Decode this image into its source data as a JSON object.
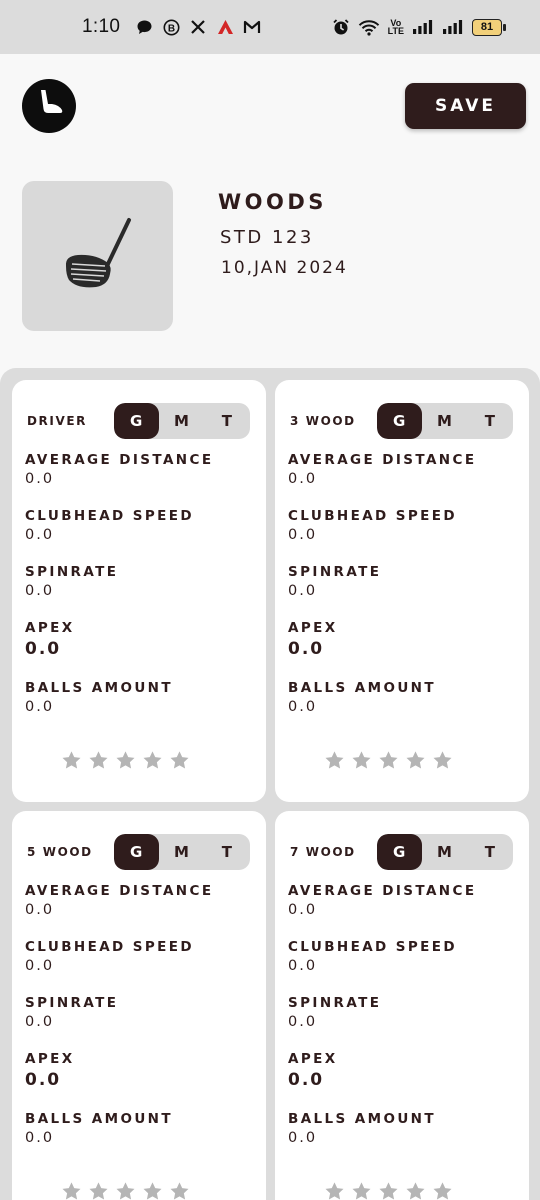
{
  "status_bar": {
    "time": "1:10",
    "volte_line1": "Vo",
    "volte_line2": "LTE",
    "battery": "81"
  },
  "header": {
    "save_label": "SAVE"
  },
  "club_info": {
    "title": "WOODS",
    "subtitle": "STD 123",
    "date": "10,JAN 2024"
  },
  "segment_options": [
    "G",
    "M",
    "T"
  ],
  "colors": {
    "primary": "#2f1c1c",
    "background": "#f8f8f8",
    "panel": "#dcdcdc",
    "star": "#b5b5b5"
  },
  "icons": {
    "logo": "golf-club-logo-icon",
    "club_image": "golf-driver-icon",
    "rating": "star-icon"
  },
  "cards": [
    {
      "name": "DRIVER",
      "selected": "G",
      "stats": [
        {
          "label": "AVERAGE DISTANCE",
          "value": "0.0"
        },
        {
          "label": "CLUBHEAD SPEED",
          "value": "0.0"
        },
        {
          "label": "SPINRATE",
          "value": "0.0"
        },
        {
          "label": "APEX",
          "value": "0.0"
        },
        {
          "label": "BALLS AMOUNT",
          "value": "0.0"
        }
      ],
      "rating": 0
    },
    {
      "name": "3 WOOD",
      "selected": "G",
      "stats": [
        {
          "label": "AVERAGE DISTANCE",
          "value": "0.0"
        },
        {
          "label": "CLUBHEAD SPEED",
          "value": "0.0"
        },
        {
          "label": "SPINRATE",
          "value": "0.0"
        },
        {
          "label": "APEX",
          "value": "0.0"
        },
        {
          "label": "BALLS AMOUNT",
          "value": "0.0"
        }
      ],
      "rating": 0
    },
    {
      "name": "5 WOOD",
      "selected": "G",
      "stats": [
        {
          "label": "AVERAGE DISTANCE",
          "value": "0.0"
        },
        {
          "label": "CLUBHEAD SPEED",
          "value": "0.0"
        },
        {
          "label": "SPINRATE",
          "value": "0.0"
        },
        {
          "label": "APEX",
          "value": "0.0"
        },
        {
          "label": "BALLS AMOUNT",
          "value": "0.0"
        }
      ],
      "rating": 0
    },
    {
      "name": "7 WOOD",
      "selected": "G",
      "stats": [
        {
          "label": "AVERAGE DISTANCE",
          "value": "0.0"
        },
        {
          "label": "CLUBHEAD SPEED",
          "value": "0.0"
        },
        {
          "label": "SPINRATE",
          "value": "0.0"
        },
        {
          "label": "APEX",
          "value": "0.0"
        },
        {
          "label": "BALLS AMOUNT",
          "value": "0.0"
        }
      ],
      "rating": 0
    }
  ]
}
